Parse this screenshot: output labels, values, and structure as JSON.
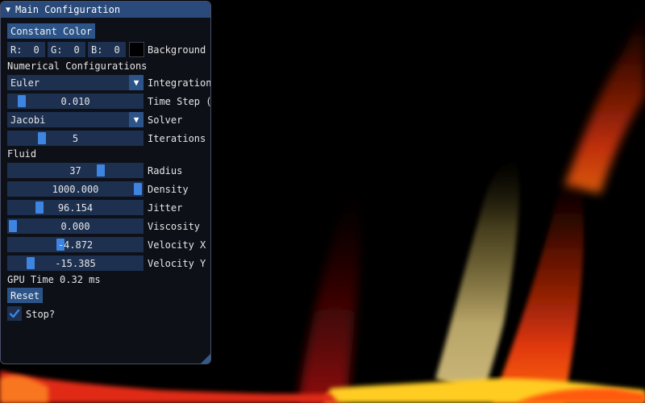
{
  "window": {
    "title": "Main Configuration",
    "collapse_glyph": "▼"
  },
  "background_color": {
    "mode_button": "Constant Color",
    "r_label": "R:",
    "r_value": "0",
    "g_label": "G:",
    "g_value": "0",
    "b_label": "B:",
    "b_value": "0",
    "label": "Background",
    "swatch_hex": "#000000"
  },
  "numerical": {
    "header": "Numerical Configurations",
    "integration": {
      "value": "Euler",
      "label": "Integration"
    },
    "time_step": {
      "value": "0.010",
      "label": "Time Step (",
      "fraction": 0.07
    },
    "solver": {
      "value": "Jacobi",
      "label": "Solver"
    },
    "iterations": {
      "value": "5",
      "label": "Iterations",
      "fraction": 0.23
    }
  },
  "fluid": {
    "header": "Fluid",
    "radius": {
      "value": "37",
      "label": "Radius",
      "fraction": 0.7
    },
    "density": {
      "value": "1000.000",
      "label": "Density",
      "fraction": 1.0
    },
    "jitter": {
      "value": "96.154",
      "label": "Jitter",
      "fraction": 0.21
    },
    "viscosity": {
      "value": "0.000",
      "label": "Viscosity",
      "fraction": 0.0
    },
    "velocity_x": {
      "value": "-4.872",
      "label": "Velocity X",
      "fraction": 0.38
    },
    "velocity_y": {
      "value": "-15.385",
      "label": "Velocity Y",
      "fraction": 0.14
    }
  },
  "gpu_time": "GPU Time 0.32 ms",
  "reset_button": "Reset",
  "stop": {
    "label": "Stop?",
    "checked": true
  },
  "colors": {
    "accent": "#3d85e0",
    "button": "#2c5488",
    "frame": "#1d3050",
    "title": "#294a7a"
  }
}
